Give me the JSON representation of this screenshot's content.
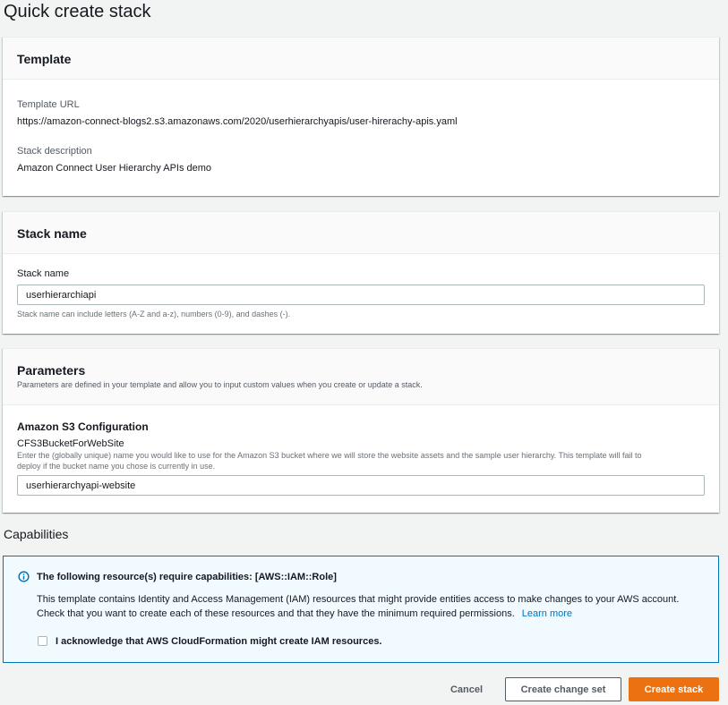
{
  "page": {
    "title": "Quick create stack"
  },
  "template": {
    "header": "Template",
    "url_label": "Template URL",
    "url_value": "https://amazon-connect-blogs2.s3.amazonaws.com/2020/userhierarchyapis/user-hirerachy-apis.yaml",
    "desc_label": "Stack description",
    "desc_value": "Amazon Connect User Hierarchy APIs demo"
  },
  "stack_name": {
    "header": "Stack name",
    "label": "Stack name",
    "value": "userhierarchiapi",
    "hint": "Stack name can include letters (A-Z and a-z), numbers (0-9), and dashes (-)."
  },
  "parameters": {
    "header": "Parameters",
    "description": "Parameters are defined in your template and allow you to input custom values when you create or update a stack.",
    "section": "Amazon S3 Configuration",
    "param_label": "CFS3BucketForWebSite",
    "param_hint_1": "Enter the (globally unique) name you would like to use for the Amazon S3 bucket where we will store the website assets and the sample user hierarchy. This template will fail to",
    "param_hint_2": "deploy if the bucket name you chose is currently in use.",
    "param_value": "userhierarchyapi-website"
  },
  "capabilities": {
    "title": "Capabilities",
    "alert_title": "The following resource(s) require capabilities: [AWS::IAM::Role]",
    "alert_line_1": "This template contains Identity and Access Management (IAM) resources that might provide entities access to make changes to your AWS account.",
    "alert_line_2": "Check that you want to create each of these resources and that they have the minimum required permissions.",
    "learn_more": "Learn more",
    "acknowledge": "I acknowledge that AWS CloudFormation might create IAM resources.",
    "acknowledged": false
  },
  "actions": {
    "cancel": "Cancel",
    "change_set": "Create change set",
    "create": "Create stack"
  },
  "colors": {
    "primary": "#ec7211",
    "link": "#0073bb",
    "alert_bg": "#f1faff"
  },
  "icons": {
    "alert": "info-icon",
    "checkbox": "checkbox-unchecked"
  }
}
